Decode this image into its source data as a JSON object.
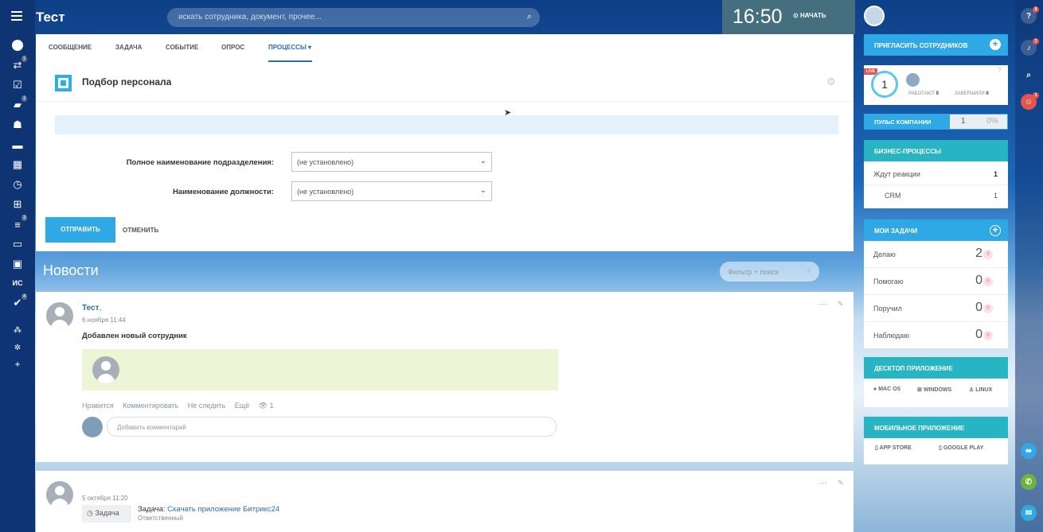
{
  "header": {
    "app_title": "Тест",
    "search_placeholder": "искать сотрудника, документ, прочее...",
    "clock": "16:50",
    "start_label": "НАЧАТЬ"
  },
  "left_rail": {
    "badges": [
      "1",
      "1",
      "3",
      "4"
    ],
    "text_item": "ИС"
  },
  "composer": {
    "tabs": [
      "СООБЩЕНИЕ",
      "ЗАДАЧА",
      "СОБЫТИЕ",
      "ОПРОС",
      "ПРОЦЕССЫ"
    ],
    "active_tab": "ПРОЦЕССЫ",
    "process_title": "Подбор персонала",
    "fields": [
      {
        "label": "Полное наименование подразделения:",
        "value": "(не установлено)"
      },
      {
        "label": "Наименование должности:",
        "value": "(не установлено)"
      }
    ],
    "submit_label": "ОТПРАВИТЬ",
    "cancel_label": "ОТМЕНИТЬ"
  },
  "news": {
    "title": "Новости",
    "filter_placeholder": "Фильтр + поиск",
    "posts": [
      {
        "author": "Тест",
        "separator": ",",
        "date": "6 ноября 11:44",
        "text": "Добавлен новый сотрудник",
        "actions": [
          "Нравится",
          "Комментировать",
          "Не следить",
          "Ещё"
        ],
        "views": "1",
        "comment_placeholder": "Добавить комментарий"
      },
      {
        "date": "5 октября 11:20",
        "task_badge": "Задача",
        "task_prefix": "Задача:",
        "task_link": "Скачать приложение Битрикс24",
        "task_sub": "Ответственный"
      }
    ]
  },
  "right_panel": {
    "invite": "ПРИГЛАСИТЬ СОТРУДНИКОВ",
    "live": "LIVE",
    "online_count": "1",
    "working": "РАБОТАЮТ",
    "working_count": "0",
    "finished": "ЗАВЕРШИЛИ",
    "finished_count": "0",
    "pulse": "ПУЛЬС КОМПАНИИ",
    "pulse_value": "1",
    "pulse_percent": "0%",
    "bp_title": "БИЗНЕС-ПРОЦЕССЫ",
    "bp_rows": [
      {
        "label": "Ждут реакции",
        "count": "1"
      },
      {
        "label": "CRM",
        "count": "1"
      }
    ],
    "tasks_title": "МОИ ЗАДАЧИ",
    "tasks": [
      {
        "label": "Делаю",
        "count": "2",
        "badge": "0"
      },
      {
        "label": "Помогаю",
        "count": "0",
        "badge": "0"
      },
      {
        "label": "Поручил",
        "count": "0",
        "badge": "0"
      },
      {
        "label": "Наблюдаю",
        "count": "0",
        "badge": "0"
      }
    ],
    "desktop_title": "ДЕСКТОП ПРИЛОЖЕНИЕ",
    "desktop_apps": [
      "MAC OS",
      "WINDOWS",
      "LINUX"
    ],
    "mobile_title": "МОБИЛЬНОЕ ПРИЛОЖЕНИЕ",
    "mobile_apps": [
      "APP STORE",
      "GOOGLE PLAY"
    ]
  },
  "right_rail": {
    "badges": [
      "8",
      "3",
      "1"
    ]
  },
  "colors": {
    "accent": "#2fa9e5",
    "rail": "#0f3473",
    "link": "#2f6bb3"
  }
}
